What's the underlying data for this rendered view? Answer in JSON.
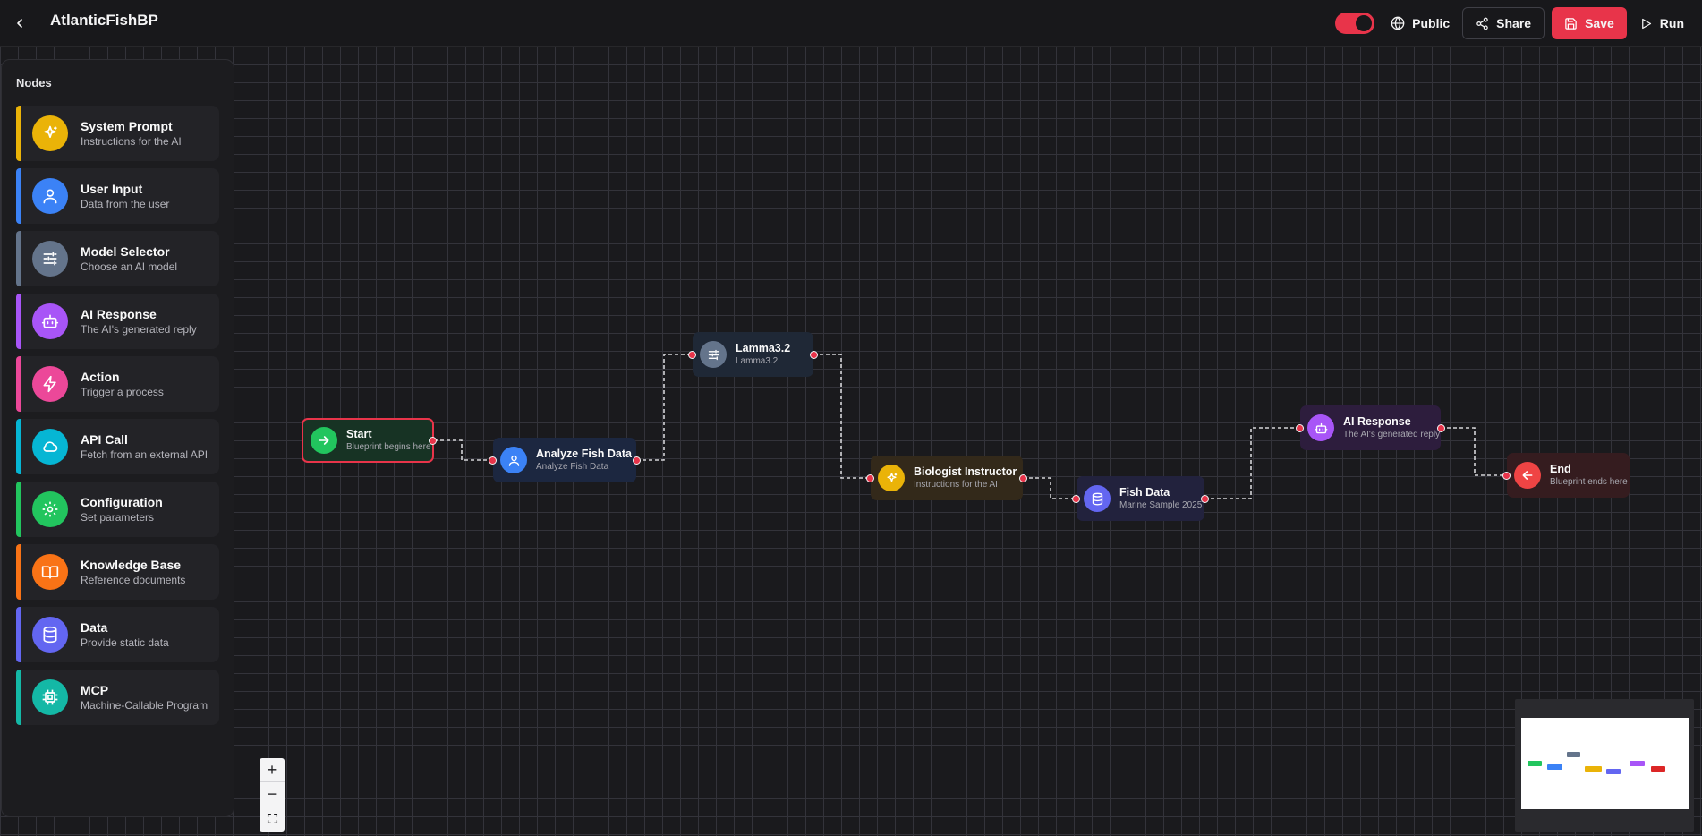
{
  "app": {
    "title": "AtlanticFishBP"
  },
  "toolbar": {
    "public_label": "Public",
    "share_label": "Share",
    "save_label": "Save",
    "run_label": "Run",
    "public_enabled": true
  },
  "sidebar": {
    "title": "Nodes",
    "items": [
      {
        "label": "System Prompt",
        "desc": "Instructions for the AI",
        "icon": "sparkles-icon",
        "color": "#eab308"
      },
      {
        "label": "User Input",
        "desc": "Data from the user",
        "icon": "user-icon",
        "color": "#3b82f6"
      },
      {
        "label": "Model Selector",
        "desc": "Choose an AI model",
        "icon": "sliders-icon",
        "color": "#64748b"
      },
      {
        "label": "AI Response",
        "desc": "The AI's generated reply",
        "icon": "bot-icon",
        "color": "#a855f7"
      },
      {
        "label": "Action",
        "desc": "Trigger a process",
        "icon": "zap-icon",
        "color": "#ec4899"
      },
      {
        "label": "API Call",
        "desc": "Fetch from an external API",
        "icon": "cloud-icon",
        "color": "#06b6d4"
      },
      {
        "label": "Configuration",
        "desc": "Set parameters",
        "icon": "gear-icon",
        "color": "#22c55e"
      },
      {
        "label": "Knowledge Base",
        "desc": "Reference documents",
        "icon": "book-icon",
        "color": "#f97316"
      },
      {
        "label": "Data",
        "desc": "Provide static data",
        "icon": "database-icon",
        "color": "#6366f1"
      },
      {
        "label": "MCP",
        "desc": "Machine-Callable Program",
        "icon": "cpu-icon",
        "color": "#14b8a6"
      }
    ]
  },
  "canvas": {
    "nodes": [
      {
        "id": "start",
        "title": "Start",
        "subtitle": "Blueprint begins here",
        "icon": "arrow-right-icon",
        "color": "#22c55e"
      },
      {
        "id": "analyze",
        "title": "Analyze Fish Data",
        "subtitle": "Analyze Fish Data",
        "icon": "user-icon",
        "color": "#3b82f6"
      },
      {
        "id": "lamma",
        "title": "Lamma3.2",
        "subtitle": "Lamma3.2",
        "icon": "sliders-icon",
        "color": "#64748b"
      },
      {
        "id": "biologist",
        "title": "Biologist Instructor",
        "subtitle": "Instructions for the AI",
        "icon": "sparkles-icon",
        "color": "#eab308"
      },
      {
        "id": "fishdata",
        "title": "Fish Data",
        "subtitle": "Marine Sample 2025",
        "icon": "database-icon",
        "color": "#6366f1"
      },
      {
        "id": "airesponse",
        "title": "AI Response",
        "subtitle": "The AI's generated reply",
        "icon": "bot-icon",
        "color": "#a855f7"
      },
      {
        "id": "end",
        "title": "End",
        "subtitle": "Blueprint ends here",
        "icon": "arrow-left-icon",
        "color": "#ef4444"
      }
    ],
    "selected": "start"
  }
}
